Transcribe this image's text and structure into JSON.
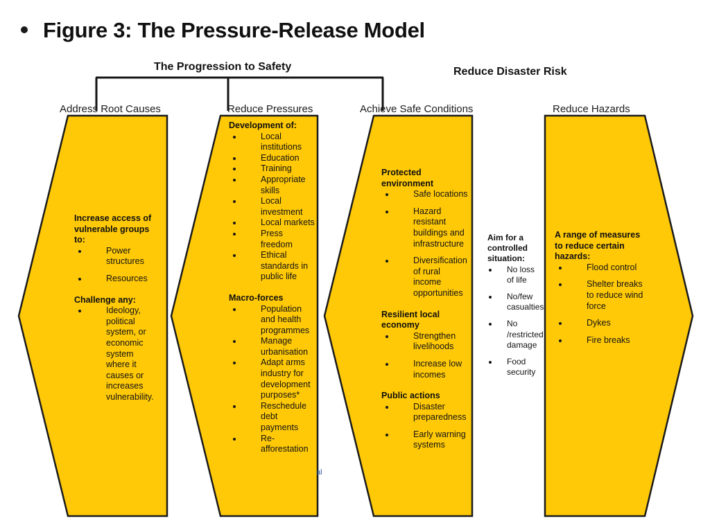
{
  "slide": {
    "title": "Figure 3: The Pressure-Release Model",
    "bullet_icon": "bullet-dot-icon"
  },
  "diagram": {
    "accent_color": "#FFC907",
    "outline_color": "#1a1a1a",
    "group_headings": [
      {
        "id": "progression",
        "label": "The Progression to Safety"
      },
      {
        "id": "risk",
        "label": "Reduce Disaster Risk"
      }
    ],
    "columns": [
      {
        "id": "address-root-causes",
        "heading": "Address Root Causes",
        "direction": "left",
        "sections": [
          {
            "title": "Increase access of vulnerable groups to:",
            "items": [
              "Power structures",
              "Resources"
            ]
          },
          {
            "title": "Challenge any:",
            "items": [
              "Ideology, political system, or economic system where it causes or increases vulnerability."
            ]
          }
        ]
      },
      {
        "id": "reduce-pressures",
        "heading": "Reduce Pressures",
        "direction": "left",
        "sections": [
          {
            "title": "Development of:",
            "items": [
              "Local institutions",
              "Education",
              "Training",
              "Appropriate skills",
              "Local investment",
              "Local markets",
              "Press freedom",
              "Ethical standards in public life"
            ]
          },
          {
            "title": "Macro-forces",
            "items": [
              "Population and health programmes",
              "Manage urbanisation",
              "Adapt arms industry for development purposes*",
              "Reschedule debt payments",
              "Re-afforestation"
            ]
          }
        ]
      },
      {
        "id": "achieve-safe-conditions",
        "heading": "Achieve Safe Conditions",
        "direction": "left",
        "sections": [
          {
            "title": "Protected environment",
            "items": [
              "Safe locations",
              "Hazard resistant buildings and infrastructure",
              "Diversification of rural income opportunities"
            ]
          },
          {
            "title": "Resilient local economy",
            "items": [
              "Strengthen livelihoods",
              "Increase low incomes"
            ]
          },
          {
            "title": "Public actions",
            "items": [
              "Disaster preparedness",
              "Early warning systems"
            ]
          }
        ]
      },
      {
        "id": "reduce-hazards",
        "heading": "Reduce Hazards",
        "direction": "right",
        "sections": [
          {
            "title": "A range of measures to reduce certain hazards:",
            "items": [
              "Flood control",
              "Shelter breaks to reduce wind force",
              "Dykes",
              "Fire breaks"
            ]
          }
        ]
      }
    ],
    "middle_block": {
      "id": "aim-controlled-situation",
      "title": "Aim for a controlled situation:",
      "items": [
        "No loss of life",
        "No/few casualties",
        "No /restricted damage",
        "Food security"
      ]
    },
    "footnote_fragments": [
      "al",
      "."
    ]
  }
}
